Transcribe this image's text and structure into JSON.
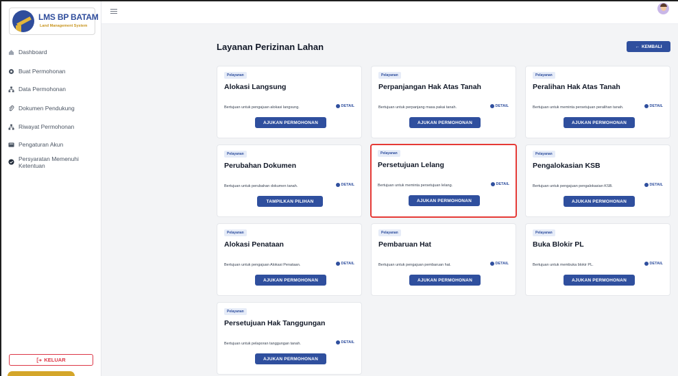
{
  "app": {
    "logo_title": "LMS BP BATAM",
    "logo_subtitle": "Land Management System"
  },
  "sidebar": {
    "items": [
      {
        "label": "Dashboard",
        "icon": "dashboard-icon"
      },
      {
        "label": "Buat Permohonan",
        "icon": "gear-icon"
      },
      {
        "label": "Data Permohonan",
        "icon": "network-icon"
      },
      {
        "label": "Dokumen Pendukung",
        "icon": "paperclip-icon"
      },
      {
        "label": "Riwayat Permohonan",
        "icon": "network-icon"
      },
      {
        "label": "Pengaturan Akun",
        "icon": "id-card-icon"
      },
      {
        "label": "Persyaratan Memenuhi Ketentuan",
        "icon": "check-circle-icon"
      }
    ],
    "logout_label": "KELUAR"
  },
  "main": {
    "title": "Layanan Perizinan Lahan",
    "back_label": "KEMBALI",
    "cards": [
      {
        "badge": "Pelayanan",
        "title": "Alokasi Langsung",
        "desc": "Bertujuan untuk pengajuan alokasi langsung.",
        "detail": "DETAIL",
        "button": "AJUKAN PERMOHONAN"
      },
      {
        "badge": "Pelayanan",
        "title": "Perpanjangan Hak Atas Tanah",
        "desc": "Bertujuan untuk perpanjang masa pakai tanah.",
        "detail": "DETAIL",
        "button": "AJUKAN PERMOHONAN"
      },
      {
        "badge": "Pelayanan",
        "title": "Peralihan Hak Atas Tanah",
        "desc": "Bertujuan untuk meminta persetujuan peralihan tanah.",
        "detail": "DETAIL",
        "button": "AJUKAN PERMOHONAN"
      },
      {
        "badge": "Pelayanan",
        "title": "Perubahan Dokumen",
        "desc": "Bertujuan untuk perubahan dokumen tanah.",
        "detail": "DETAIL",
        "button": "TAMPILKAN PILIHAN"
      },
      {
        "badge": "Pelayanan",
        "title": "Persetujuan Lelang",
        "desc": "Bertujuan untuk meminta persetujuan lelang.",
        "detail": "DETAIL",
        "button": "AJUKAN PERMOHONAN"
      },
      {
        "badge": "Pelayanan",
        "title": "Pengalokasian KSB",
        "desc": "Bertujuan untuk pengajuan pengalokasian KSB.",
        "detail": "DETAIL",
        "button": "AJUKAN PERMOHONAN"
      },
      {
        "badge": "Pelayanan",
        "title": "Alokasi Penataan",
        "desc": "Bertujuan untuk pengajuan Alokasi Penataan.",
        "detail": "DETAIL",
        "button": "AJUKAN PERMOHONAN"
      },
      {
        "badge": "Pelayanan",
        "title": "Pembaruan Hat",
        "desc": "Bertujuan untuk pengajuan pembaruan hat.",
        "detail": "DETAIL",
        "button": "AJUKAN PERMOHONAN"
      },
      {
        "badge": "Pelayanan",
        "title": "Buka Blokir PL",
        "desc": "Bertujuan untuk membuka blokir PL.",
        "detail": "DETAIL",
        "button": "AJUKAN PERMOHONAN"
      },
      {
        "badge": "Pelayanan",
        "title": "Persetujuan Hak Tanggungan",
        "desc": "Bertujuan untuk pelaporan tanggungan tanah.",
        "detail": "DETAIL",
        "button": "AJUKAN PERMOHONAN"
      }
    ]
  },
  "colors": {
    "primary": "#2f4f9e",
    "accent_gold": "#d4a62a",
    "danger": "#dc3545",
    "highlight_border": "#e53935",
    "background": "#f3f4f6"
  }
}
